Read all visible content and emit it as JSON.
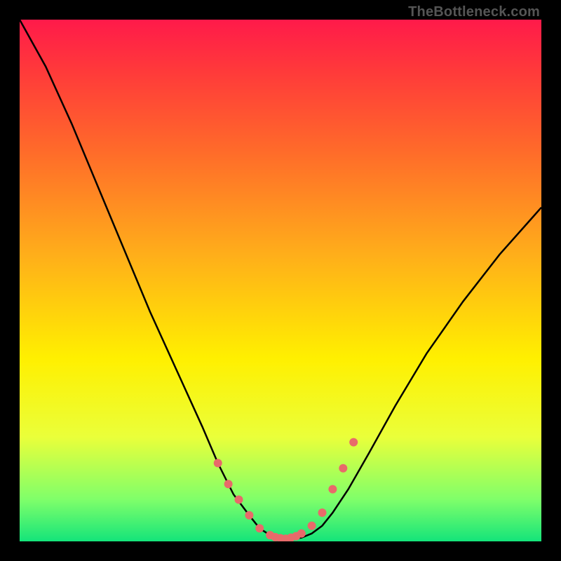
{
  "watermark": "TheBottleneck.com",
  "colors": {
    "frame": "#000000",
    "curve": "#000000",
    "dots": "#e86a6a",
    "gradient_stops": [
      "#ff1a4a",
      "#ff3a3a",
      "#ff6a2a",
      "#ffae1a",
      "#fff000",
      "#eaff3a",
      "#7fff6a",
      "#14e47a"
    ]
  },
  "chart_data": {
    "type": "line",
    "title": "",
    "xlabel": "",
    "ylabel": "",
    "xlim": [
      0,
      100
    ],
    "ylim": [
      0,
      100
    ],
    "x": [
      0,
      5,
      10,
      15,
      20,
      25,
      30,
      35,
      38,
      41,
      44,
      46,
      48,
      50,
      52,
      54,
      56,
      58,
      60,
      63,
      67,
      72,
      78,
      85,
      92,
      100
    ],
    "series": [
      {
        "name": "bottleneck-curve",
        "values": [
          100,
          91,
          80,
          68,
          56,
          44,
          33,
          22,
          15,
          9,
          5,
          2.5,
          1.2,
          0.6,
          0.5,
          0.7,
          1.5,
          3,
          5.5,
          10,
          17,
          26,
          36,
          46,
          55,
          64
        ]
      }
    ],
    "highlight_points": {
      "x": [
        38,
        40,
        42,
        44,
        46,
        48,
        49,
        50,
        51,
        52,
        53,
        54,
        56,
        58,
        60,
        62,
        64
      ],
      "y": [
        15,
        11,
        8,
        5,
        2.5,
        1.2,
        0.8,
        0.6,
        0.5,
        0.7,
        1.0,
        1.5,
        3,
        5.5,
        10,
        14,
        19
      ]
    }
  }
}
